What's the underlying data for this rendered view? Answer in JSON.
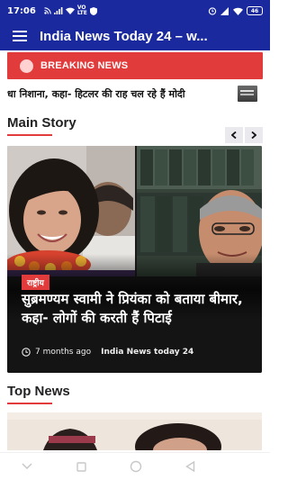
{
  "status_bar": {
    "time": "17:06",
    "network_label": "VO",
    "network_sub": "LTE",
    "battery": "46"
  },
  "app_bar": {
    "title": "India News Today 24 – w..."
  },
  "breaking": {
    "label": "BREAKING NEWS"
  },
  "ticker": {
    "text": "धा निशाना, कहा- हिटलर की राह चल रहे हैं मोदी"
  },
  "main_story": {
    "heading": "Main Story",
    "card": {
      "category": "राष्ट्रीय",
      "headline": "सुब्रमण्यम स्वामी ने प्रियंका को बताया बीमार, कहा- लोगों की करती हैं पिटाई",
      "time_ago": "7 months ago",
      "source": "India News today 24"
    }
  },
  "top_news": {
    "heading": "Top News"
  },
  "colors": {
    "primary": "#1a2a9e",
    "accent": "#e23b3b"
  }
}
